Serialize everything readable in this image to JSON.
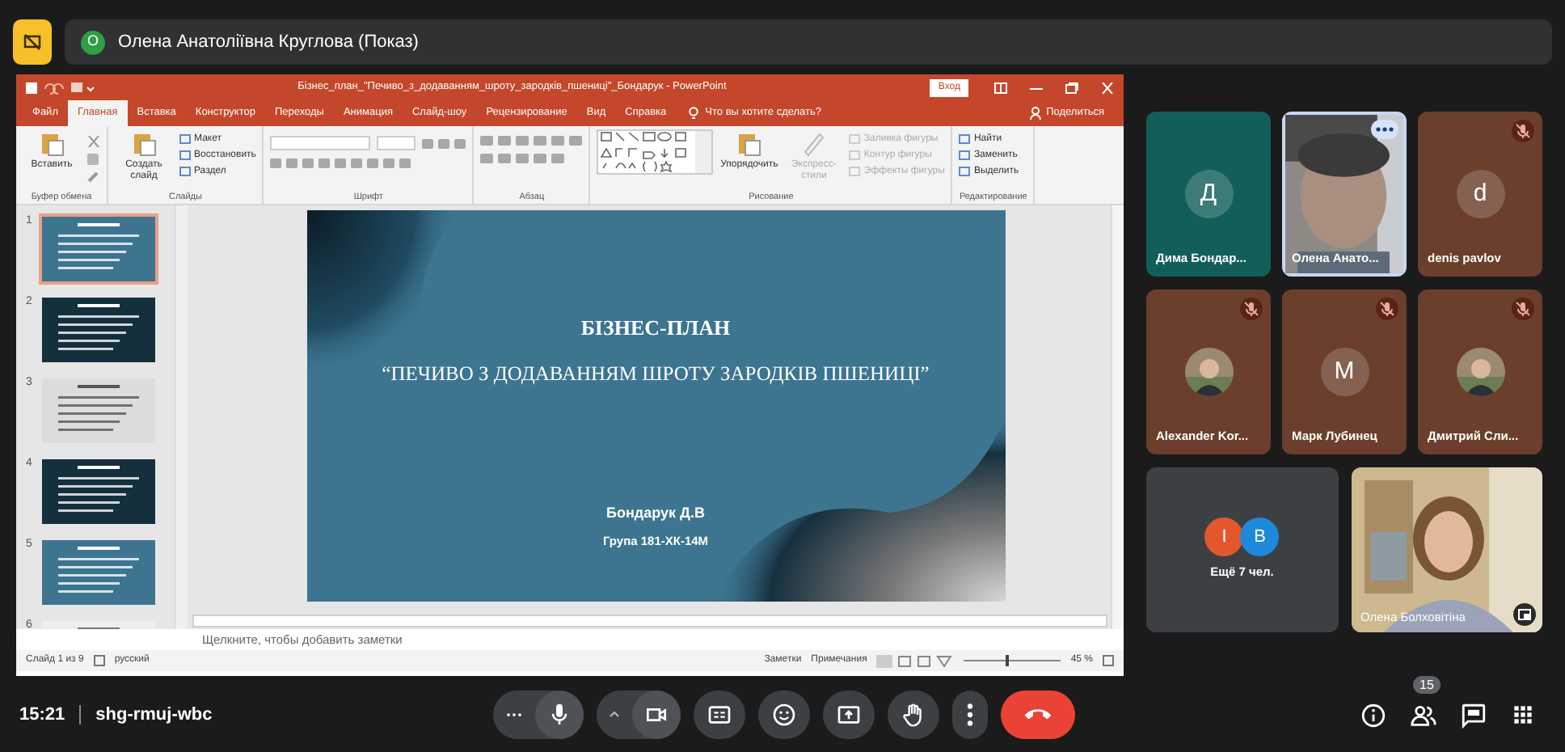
{
  "top_bar": {
    "presenter_initial": "О",
    "presenter_label": "Олена Анатоліївна Круглова (Показ)"
  },
  "powerpoint": {
    "title": "Бізнес_план_\"Печиво_з_додаванням_шроту_зародків_пшениці\"_Бондарук - PowerPoint",
    "signin": "Вход",
    "tabs": [
      {
        "label": "Файл",
        "selected": false
      },
      {
        "label": "Главная",
        "selected": true
      },
      {
        "label": "Вставка",
        "selected": false
      },
      {
        "label": "Конструктор",
        "selected": false
      },
      {
        "label": "Переходы",
        "selected": false
      },
      {
        "label": "Анимация",
        "selected": false
      },
      {
        "label": "Слайд-шоу",
        "selected": false
      },
      {
        "label": "Рецензирование",
        "selected": false
      },
      {
        "label": "Вид",
        "selected": false
      },
      {
        "label": "Справка",
        "selected": false
      }
    ],
    "tell_me": "Что вы хотите сделать?",
    "share": "Поделиться",
    "ribbon": [
      {
        "label": "Буфер обмена",
        "items": [
          {
            "kind": "large",
            "label": "Вставить",
            "disabled": false
          },
          {
            "kind": "icon-column"
          }
        ]
      },
      {
        "label": "Слайды",
        "items": [
          {
            "kind": "large",
            "label": "Создать слайд",
            "disabled": false
          },
          {
            "kind": "stack",
            "entries": [
              {
                "label": "Макет",
                "disabled": false
              },
              {
                "label": "Восстановить",
                "disabled": false
              },
              {
                "label": "Раздел",
                "disabled": false
              }
            ]
          }
        ]
      },
      {
        "label": "Шрифт",
        "items": [
          {
            "kind": "font-controls"
          }
        ]
      },
      {
        "label": "Абзац",
        "items": [
          {
            "kind": "paragraph-controls"
          }
        ]
      },
      {
        "label": "Рисование",
        "items": [
          {
            "kind": "shapes-gallery"
          },
          {
            "kind": "large",
            "label": "Упорядочить",
            "disabled": false
          },
          {
            "kind": "large",
            "label": "Экспресс-стили",
            "disabled": true
          },
          {
            "kind": "stack",
            "entries": [
              {
                "label": "Заливка фигуры",
                "disabled": true
              },
              {
                "label": "Контур фигуры",
                "disabled": true
              },
              {
                "label": "Эффекты фигуры",
                "disabled": true
              }
            ]
          }
        ]
      },
      {
        "label": "Редактирование",
        "items": [
          {
            "kind": "stack",
            "entries": [
              {
                "label": "Найти",
                "disabled": false
              },
              {
                "label": "Заменить",
                "disabled": false
              },
              {
                "label": "Выделить",
                "disabled": false
              }
            ]
          }
        ]
      }
    ],
    "thumbnails": [
      {
        "number": "1",
        "kind": "teal",
        "selected": true
      },
      {
        "number": "2",
        "kind": "dark",
        "selected": false
      },
      {
        "number": "3",
        "kind": "light",
        "selected": false
      },
      {
        "number": "4",
        "kind": "dark",
        "selected": false
      },
      {
        "number": "5",
        "kind": "teal",
        "selected": false
      },
      {
        "number": "6",
        "kind": "table",
        "selected": false
      }
    ],
    "slide": {
      "title": "БІЗНЕС-ПЛАН",
      "subtitle": "“ПЕЧИВО З ДОДАВАННЯМ ШРОТУ ЗАРОДКІВ ПШЕНИЦІ”",
      "author": "Бондарук Д.В",
      "group": "Група 181-ХК-14М"
    },
    "notes_hint": "Щелкните, чтобы добавить заметки",
    "status_bar": {
      "slide_counter": "Слайд 1 из 9",
      "language": "русский",
      "notes": "Заметки",
      "comments": "Примечания",
      "zoom": "45 %",
      "zoom_slider": {
        "level": 0.42
      }
    }
  },
  "participants": [
    {
      "name": "Дима Бондар...",
      "kind": "letter",
      "letter": "Д",
      "color": "#125f5a",
      "muted": false,
      "speaking": false
    },
    {
      "name": "Олена Анато...",
      "kind": "video",
      "color": "#6f6a66",
      "muted": false,
      "speaking": true
    },
    {
      "name": "denis pavlov",
      "kind": "letter",
      "letter": "d",
      "color": "#6b3f2b",
      "muted": true,
      "speaking": false
    },
    {
      "name": "Alexander Kor...",
      "color": "#6b3f2b",
      "muted": true,
      "speaking": false
    },
    {
      "name": "Марк Лубинец",
      "kind": "letter",
      "letter": "M",
      "color": "#6b3f2b",
      "muted": true,
      "speaking": false
    },
    {
      "name": "Дмитрий Сли...",
      "color": "#6b3f2b",
      "muted": true,
      "speaking": false
    }
  ],
  "others": {
    "label": "Ещё 7 чел.",
    "avatars": [
      {
        "letter": "I",
        "color": "#e4572e"
      },
      {
        "letter": "B",
        "color": "#1e88d9"
      }
    ]
  },
  "self_view": {
    "name": "Олена Болховітіна"
  },
  "bottom_bar": {
    "time": "15:21",
    "meeting_code": "shg-rmuj-wbc",
    "people_count": "15"
  }
}
